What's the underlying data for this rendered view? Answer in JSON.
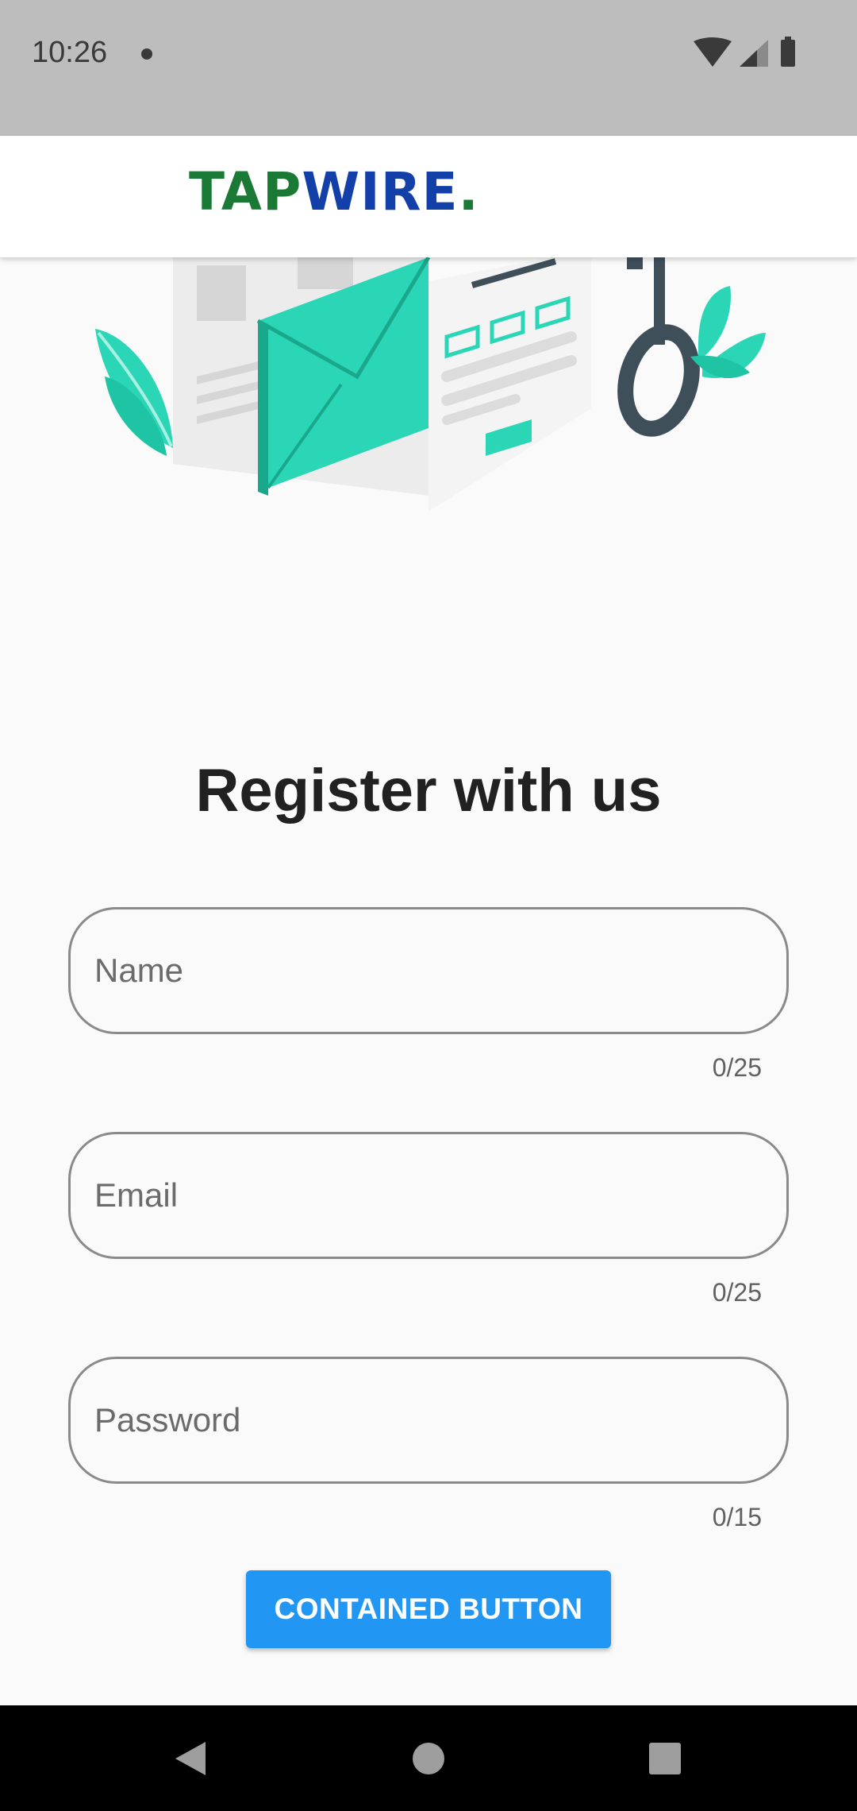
{
  "status_bar": {
    "time": "10:26"
  },
  "app_bar": {
    "logo_tap": "TAP",
    "logo_wire": "WIRE",
    "logo_dot": ".",
    "colors": {
      "green": "#1a7a35",
      "blue": "#1340a8"
    }
  },
  "register": {
    "heading": "Register with us",
    "fields": [
      {
        "placeholder": "Name",
        "value": "",
        "counter": "0/25"
      },
      {
        "placeholder": "Email",
        "value": "",
        "counter": "0/25"
      },
      {
        "placeholder": "Password",
        "value": "",
        "counter": "0/15"
      }
    ],
    "button_label": "CONTAINED BUTTON",
    "accent": "#2196f3"
  },
  "icons": {
    "status": [
      "wifi-icon",
      "cellular-signal-icon",
      "battery-icon"
    ],
    "nav": [
      "back-icon",
      "home-icon",
      "recents-icon"
    ]
  }
}
